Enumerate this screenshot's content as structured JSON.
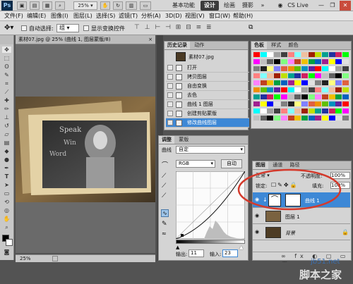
{
  "titlebar": {
    "logo": "Ps",
    "zoom": "25%",
    "workspaces": [
      "基本功能",
      "设计",
      "绘画",
      "摄影"
    ],
    "active_workspace": "设计",
    "cs_live": "CS Live"
  },
  "menu": [
    "文件(F)",
    "编辑(E)",
    "图像(I)",
    "图层(L)",
    "选择(S)",
    "滤镜(T)",
    "分析(A)",
    "3D(D)",
    "视图(V)",
    "窗口(W)",
    "帮助(H)"
  ],
  "options": {
    "auto_select_label": "自动选择:",
    "auto_select_value": "组",
    "show_transform_label": "显示变换控件"
  },
  "document": {
    "tab_title": "素材07.jpg @ 25% (曲线 1, 图层蒙版/8)",
    "image_text_1": "Speak",
    "image_text_2": "Win",
    "image_text_3": "Word"
  },
  "statusbar": {
    "zoom": "25%"
  },
  "history": {
    "tabs": [
      "历史记录",
      "动作"
    ],
    "snapshot": "素材07.jpg",
    "items": [
      "打开",
      "拷贝图层",
      "自由变换",
      "去色",
      "曲线 1 图层",
      "创建剪贴蒙版",
      "修改曲线图层"
    ],
    "selected_index": 6
  },
  "swatches": {
    "tabs": [
      "色板",
      "样式",
      "颜色"
    ],
    "colors": [
      "#ff0000",
      "#ffff00",
      "#00ff00",
      "#00ffff",
      "#0000ff",
      "#ff00ff",
      "#ffffff",
      "#e0e0e0",
      "#c0c0c0",
      "#a0a0a0",
      "#808080",
      "#606060",
      "#404040",
      "#202020",
      "#000000",
      "#ff8080",
      "#ffff80",
      "#80ff80",
      "#80ffff",
      "#8080ff",
      "#ff80ff",
      "#f0c0a0",
      "#e06040",
      "#c04020",
      "#a02000",
      "#f09000",
      "#f0c000",
      "#c0e000",
      "#60c000",
      "#00a040",
      "#00a090",
      "#0090c0",
      "#0060c0",
      "#2030a0",
      "#6020a0",
      "#a02090",
      "#d02060"
    ]
  },
  "adjust": {
    "tabs": [
      "调整",
      "蒙版"
    ],
    "title": "曲线",
    "preset": "自定",
    "channel": "RGB",
    "auto_label": "自动",
    "output_label": "输出:",
    "output_value": "11",
    "input_label": "输入:",
    "input_value": "23"
  },
  "layers": {
    "tabs": [
      "图层",
      "通道",
      "路径"
    ],
    "blend_mode": "正常",
    "opacity_label": "不透明度:",
    "opacity_value": "100%",
    "lock_label": "锁定:",
    "fill_label": "填充:",
    "fill_value": "100%",
    "rows": [
      {
        "name": "曲线 1",
        "selected": true
      },
      {
        "name": "图层 1",
        "selected": false
      },
      {
        "name": "背景",
        "selected": false
      }
    ]
  },
  "watermark": {
    "url": "jb51.net",
    "text": "脚本之家"
  }
}
